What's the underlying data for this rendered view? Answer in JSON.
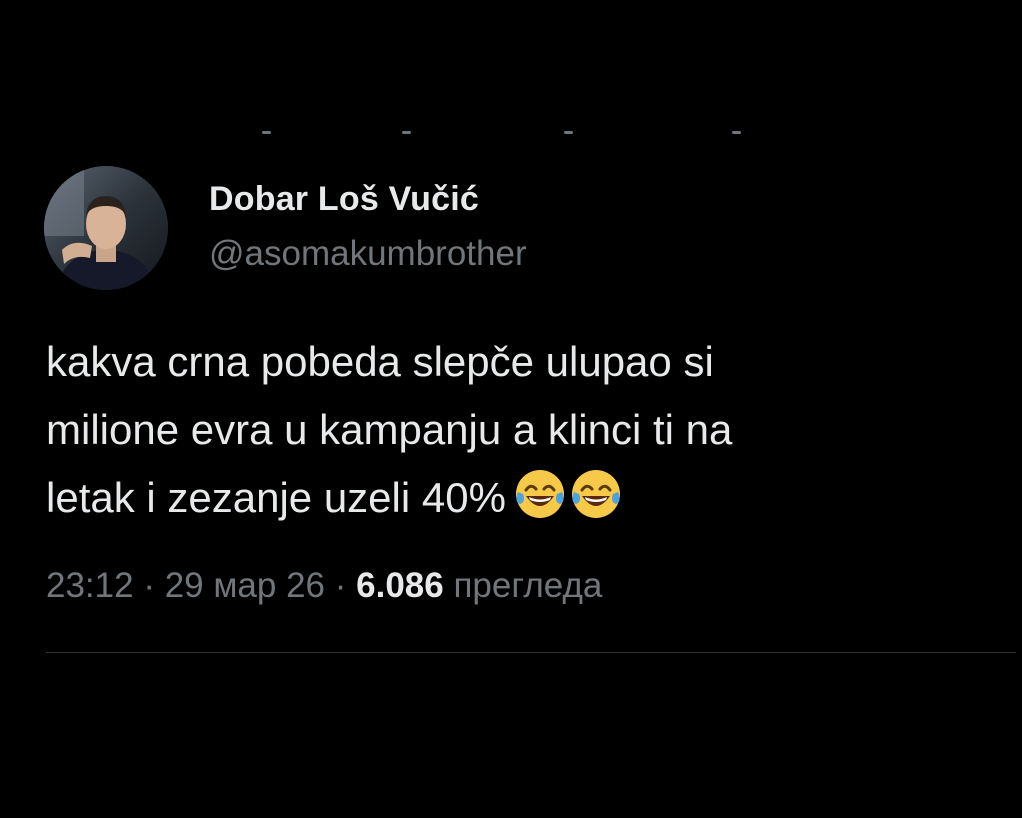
{
  "tweet": {
    "author": {
      "display_name": "Dobar Loš Vučić",
      "handle": "@asomakumbrother"
    },
    "text": "kakva crna pobeda slepče ulupao si\nmilione evra u kampanju a klinci ti na\nletak i zezanje uzeli 40%",
    "emojis": [
      "face-with-tears-of-joy",
      "face-with-tears-of-joy"
    ],
    "time": "23:12",
    "separator": "·",
    "date": "29 мар 26",
    "views_count": "6.086",
    "views_label": "прегледа"
  },
  "colors": {
    "background": "#000000",
    "primary_text": "#e7e9ea",
    "secondary_text": "#71767b",
    "divider": "#2f3336"
  }
}
